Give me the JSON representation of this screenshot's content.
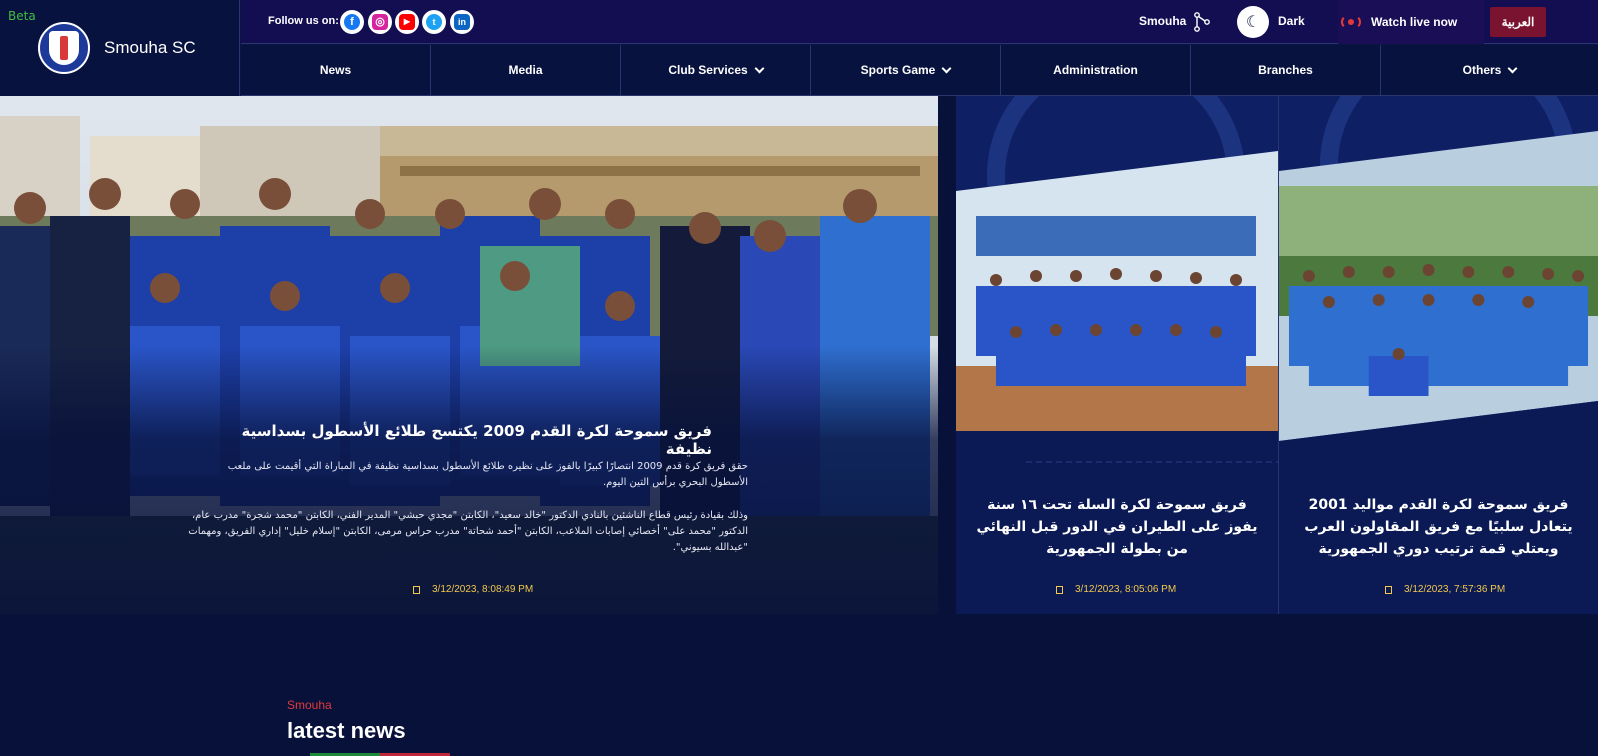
{
  "header": {
    "beta": "Beta",
    "site_title": "Smouha SC",
    "follow_label": "Follow us on:",
    "social": [
      {
        "name": "facebook-icon",
        "glyph": "f"
      },
      {
        "name": "instagram-icon",
        "glyph": "◎"
      },
      {
        "name": "youtube-icon",
        "glyph": "▶"
      },
      {
        "name": "twitter-icon",
        "glyph": "t"
      },
      {
        "name": "linkedin-icon",
        "glyph": "in"
      }
    ],
    "brand_link": "Smouha",
    "theme_label": "Dark",
    "live_label": "Watch live now",
    "lang_button": "العربية"
  },
  "nav": [
    {
      "label": "News",
      "dropdown": false
    },
    {
      "label": "Media",
      "dropdown": false
    },
    {
      "label": "Club Services",
      "dropdown": true
    },
    {
      "label": "Sports Game",
      "dropdown": true
    },
    {
      "label": "Administration",
      "dropdown": false
    },
    {
      "label": "Branches",
      "dropdown": false
    },
    {
      "label": "Others",
      "dropdown": true
    }
  ],
  "hero": {
    "main": {
      "title": "فريق سموحة لكرة القدم 2009 يكتسح طلائع الأسطول بسداسية نظيفة",
      "paragraph_1": "حقق فريق كرة قدم 2009 انتصارًا كبيرًا بالفوز على نظيره طلائع الأسطول بسداسية نظيفة في المباراة التي أقيمت على ملعب الأسطول البحري برأس التين اليوم.",
      "paragraph_2": "وذلك بقيادة رئيس قطاع الناشئين بالنادي الدكتور \"خالد سعيد\"، الكابتن \"مجدي حبشي\" المدير الفني، الكابتن \"محمد شجرة\" مدرب عام، الدكتور \"محمد على\" أخصائي إصابات الملاعب، الكابتن \"أحمد شحاتة\" مدرب حراس مرمى، الكابتن \"إسلام خليل\" إداري الفريق، ومهمات \"عبدالله بسيوني\".",
      "date": "3/12/2023, 8:08:49 PM"
    },
    "cards": [
      {
        "title": "فريق سموحة لكرة السلة تحت ١٦ سنة يفوز على الطيران في الدور قبل النهائي من بطولة الجمهورية",
        "date": "3/12/2023, 8:05:06 PM"
      },
      {
        "title": "فريق سموحة لكرة القدم مواليد 2001 يتعادل سلبيًا مع فريق المقاولون العرب ويعتلي قمة ترتيب دوري الجمهورية",
        "date": "3/12/2023, 7:57:36 PM"
      }
    ]
  },
  "latest": {
    "kicker": "Smouha",
    "title": "latest news"
  },
  "colors": {
    "background": "#07113a",
    "topbar": "#130d52",
    "lang_button": "#7a1330",
    "live_red": "#e23a3a",
    "date_gold": "#f2c94c",
    "kicker_red": "#e23a3a"
  }
}
